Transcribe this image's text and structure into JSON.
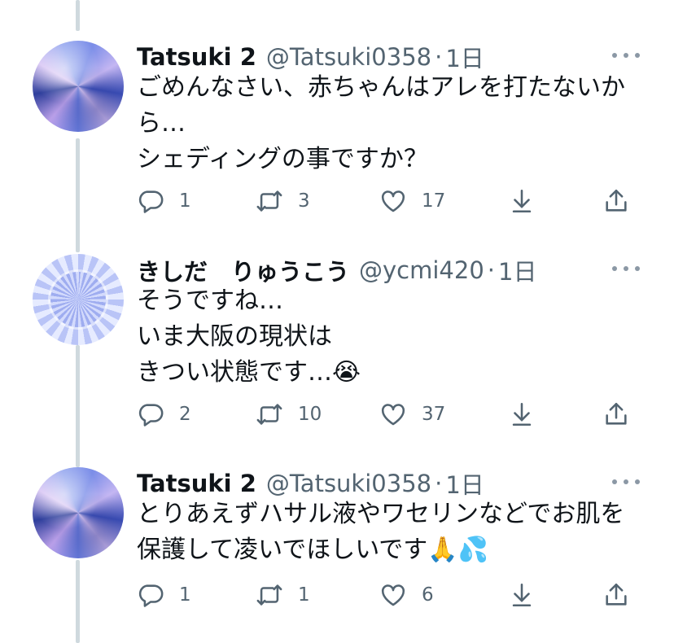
{
  "tweets": [
    {
      "name": "Tatsuki 2",
      "handle": "@Tatsuki0358",
      "sep": "·",
      "time": "1日",
      "lines": [
        "ごめんなさい、赤ちゃんはアレを打たないか",
        "ら…",
        "シェディングの事ですか？"
      ],
      "replies": "1",
      "retweets": "3",
      "likes": "17",
      "avatar": "blue-crystal-gem"
    },
    {
      "name": "きしだ　りゅうこう",
      "handle": "@ycmi420",
      "sep": "·",
      "time": "1日",
      "lines": [
        "そうですね…",
        "いま大阪の現状は",
        "きつい状態です…😭"
      ],
      "replies": "2",
      "retweets": "10",
      "likes": "37",
      "avatar": "spiral-pattern"
    },
    {
      "name": "Tatsuki 2",
      "handle": "@Tatsuki0358",
      "sep": "·",
      "time": "1日",
      "lines": [
        "とりあえずハサル液やワセリンなどでお肌を",
        "保護して凌いでほしいです🙏💦"
      ],
      "replies": "1",
      "retweets": "1",
      "likes": "6",
      "avatar": "blue-crystal-gem"
    }
  ],
  "icons": {
    "reply": "reply-icon",
    "retweet": "retweet-icon",
    "like": "like-icon",
    "download": "download-icon",
    "share": "share-icon",
    "more": "more-icon"
  },
  "colors": {
    "text": "#0f1419",
    "secondary": "#536471",
    "thread_line": "#cfd9de"
  }
}
